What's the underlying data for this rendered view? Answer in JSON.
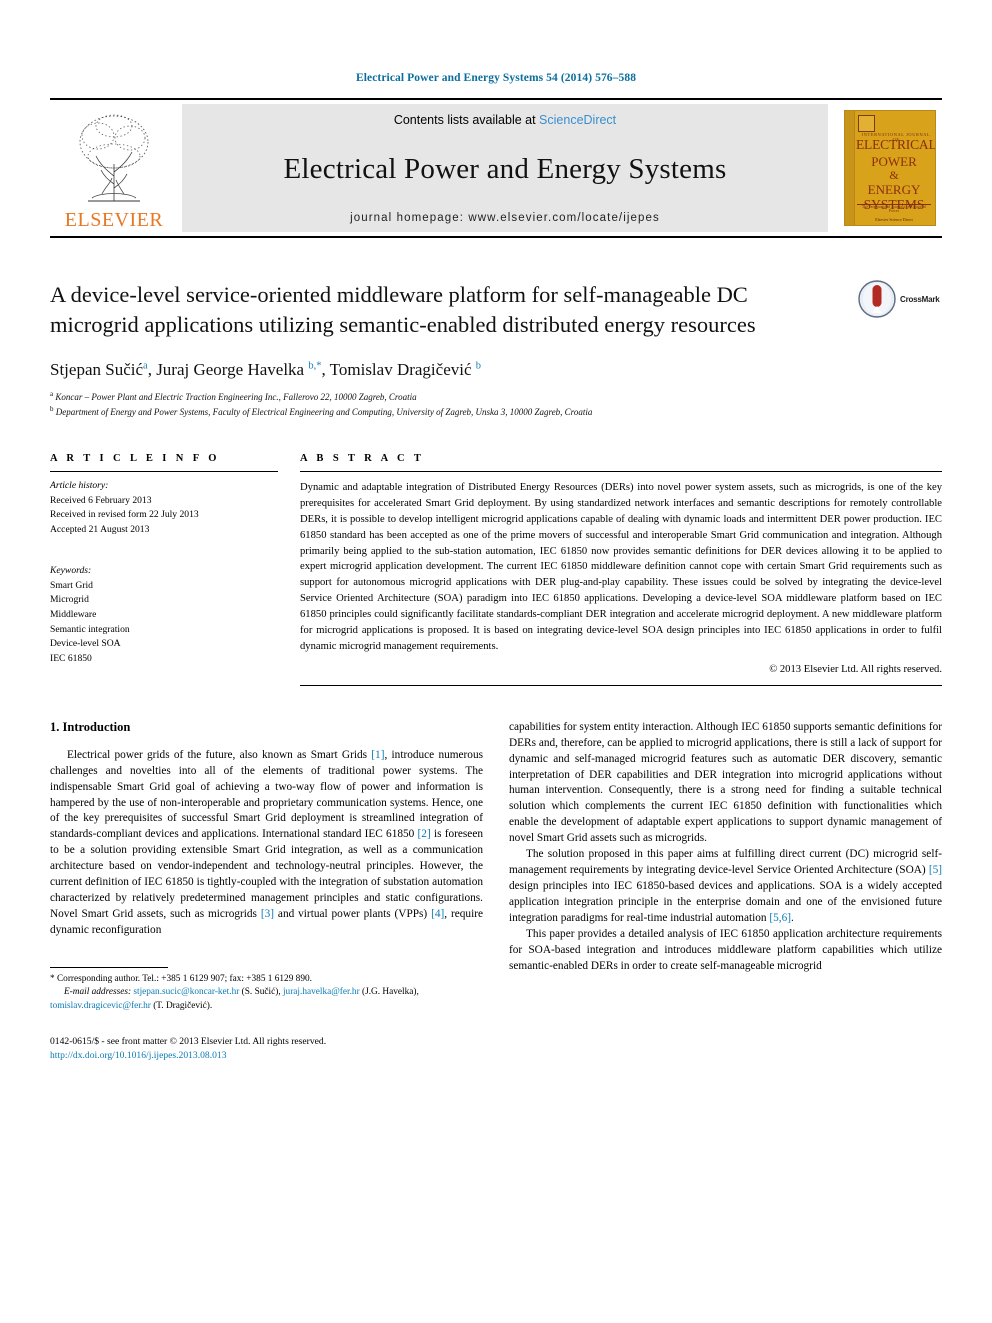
{
  "running_head": "Electrical Power and Energy Systems 54 (2014) 576–588",
  "masthead": {
    "publisher_name": "ELSEVIER",
    "contents_prefix": "Contents lists available at ",
    "contents_link": "ScienceDirect",
    "journal_name": "Electrical Power and Energy Systems",
    "homepage": "journal homepage: www.elsevier.com/locate/ijepes",
    "cover": {
      "top_sub": "INTERNATIONAL JOURNAL OF",
      "line1": "ELECTRICAL",
      "line2": "POWER",
      "line3": "&",
      "line4": "ENERGY",
      "line5": "SYSTEMS",
      "tagline": "The International Journal for Electrical Power",
      "brand": "Elsevier Science Direct"
    }
  },
  "article": {
    "title": "A device-level service-oriented middleware platform for self-manageable DC microgrid applications utilizing semantic-enabled distributed energy resources",
    "crossmark_label": "CrossMark",
    "authors": [
      {
        "name": "Stjepan Sučić",
        "marks": "a"
      },
      {
        "name": "Juraj George Havelka",
        "marks": "b,*"
      },
      {
        "name": "Tomislav Dragičević",
        "marks": "b"
      }
    ],
    "affiliations": [
      {
        "mark": "a",
        "text": "Koncar – Power Plant and Electric Traction Engineering Inc., Fallerovo 22, 10000 Zagreb, Croatia"
      },
      {
        "mark": "b",
        "text": "Department of Energy and Power Systems, Faculty of Electrical Engineering and Computing, University of Zagreb, Unska 3, 10000 Zagreb, Croatia"
      }
    ]
  },
  "article_info": {
    "heading": "A R T I C L E   I N F O",
    "history_label": "Article history:",
    "history": [
      "Received 6 February 2013",
      "Received in revised form 22 July 2013",
      "Accepted 21 August 2013"
    ],
    "keywords_label": "Keywords:",
    "keywords": [
      "Smart Grid",
      "Microgrid",
      "Middleware",
      "Semantic integration",
      "Device-level SOA",
      "IEC 61850"
    ]
  },
  "abstract": {
    "heading": "A B S T R A C T",
    "text": "Dynamic and adaptable integration of Distributed Energy Resources (DERs) into novel power system assets, such as microgrids, is one of the key prerequisites for accelerated Smart Grid deployment. By using standardized network interfaces and semantic descriptions for remotely controllable DERs, it is possible to develop intelligent microgrid applications capable of dealing with dynamic loads and intermittent DER power production. IEC 61850 standard has been accepted as one of the prime movers of successful and interoperable Smart Grid communication and integration. Although primarily being applied to the sub-station automation, IEC 61850 now provides semantic definitions for DER devices allowing it to be applied to expert microgrid application development. The current IEC 61850 middleware definition cannot cope with certain Smart Grid requirements such as support for autonomous microgrid applications with DER plug-and-play capability. These issues could be solved by integrating the device-level Service Oriented Architecture (SOA) paradigm into IEC 61850 applications. Developing a device-level SOA middleware platform based on IEC 61850 principles could significantly facilitate standards-compliant DER integration and accelerate microgrid deployment. A new middleware platform for microgrid applications is proposed. It is based on integrating device-level SOA design principles into IEC 61850 applications in order to fulfil dynamic microgrid management requirements.",
    "copyright": "© 2013 Elsevier Ltd. All rights reserved."
  },
  "body": {
    "section_title": "1. Introduction",
    "left_paragraphs": [
      {
        "runs": [
          {
            "t": "Electrical power grids of the future, also known as Smart Grids "
          },
          {
            "t": "[1]",
            "k": "ref"
          },
          {
            "t": ", introduce numerous challenges and novelties into all of the elements of traditional power systems. The indispensable Smart Grid goal of achieving a two-way flow of power and information is hampered by the use of non-interoperable and proprietary communication systems. Hence, one of the key prerequisites of successful Smart Grid deployment is streamlined integration of standards-compliant devices and applications. International standard IEC 61850 "
          },
          {
            "t": "[2]",
            "k": "ref"
          },
          {
            "t": " is foreseen to be a solution providing extensible Smart Grid integration, as well as a communication architecture based on vendor-independent and technology-neutral principles. However, the current definition of IEC 61850 is tightly-coupled with the integration of substation automation characterized by relatively predetermined management principles and static configurations. Novel Smart Grid assets, such as microgrids "
          },
          {
            "t": "[3]",
            "k": "ref"
          },
          {
            "t": " and virtual power plants (VPPs) "
          },
          {
            "t": "[4]",
            "k": "ref"
          },
          {
            "t": ", require dynamic reconfiguration"
          }
        ]
      }
    ],
    "right_paragraphs": [
      {
        "runs": [
          {
            "t": "capabilities for system entity interaction. Although IEC 61850 supports semantic definitions for DERs and, therefore, can be applied to microgrid applications, there is still a lack of support for dynamic and self-managed microgrid features such as automatic DER discovery, semantic interpretation of DER capabilities and DER integration into microgrid applications without human intervention. Consequently, there is a strong need for finding a suitable technical solution which complements the current IEC 61850 definition with functionalities which enable the development of adaptable expert applications to support dynamic management of novel Smart Grid assets such as microgrids."
          }
        ],
        "no_indent": true
      },
      {
        "runs": [
          {
            "t": "The solution proposed in this paper aims at fulfilling direct current (DC) microgrid self-management requirements by integrating device-level Service Oriented Architecture (SOA) "
          },
          {
            "t": "[5]",
            "k": "ref"
          },
          {
            "t": " design principles into IEC 61850-based devices and applications. SOA is a widely accepted application integration principle in the enterprise domain and one of the envisioned future integration paradigms for real-time industrial automation "
          },
          {
            "t": "[5,6]",
            "k": "ref"
          },
          {
            "t": "."
          }
        ]
      },
      {
        "runs": [
          {
            "t": "This paper provides a detailed analysis of IEC 61850 application architecture requirements for SOA-based integration and introduces middleware platform capabilities which utilize semantic-enabled DERs in order to create self-manageable microgrid"
          }
        ]
      }
    ]
  },
  "footnote": {
    "corresponding": "* Corresponding author. Tel.: +385 1 6129 907; fax: +385 1 6129 890.",
    "email_label": "E-mail addresses:",
    "emails": [
      {
        "address": "stjepan.sucic@koncar-ket.hr",
        "owner": "(S. Sučić)"
      },
      {
        "address": "juraj.havelka@fer.hr",
        "owner": "(J.G. Havelka)"
      },
      {
        "address": "tomislav.dragicevic@fer.hr",
        "owner": "(T. Dragičević)"
      }
    ],
    "issn_line": "0142-0615/$ - see front matter © 2013 Elsevier Ltd. All rights reserved.",
    "doi": "http://dx.doi.org/10.1016/j.ijepes.2013.08.013"
  },
  "colors": {
    "link_blue": "#0b7bb5",
    "running_head_blue": "#0b6f9d",
    "sciencedirect_blue": "#3a8fd0",
    "elsevier_orange": "#e87722",
    "cover_gold": "#d9a21b",
    "cover_red": "#8c2d0e",
    "banner_gray": "#e6e6e6"
  }
}
